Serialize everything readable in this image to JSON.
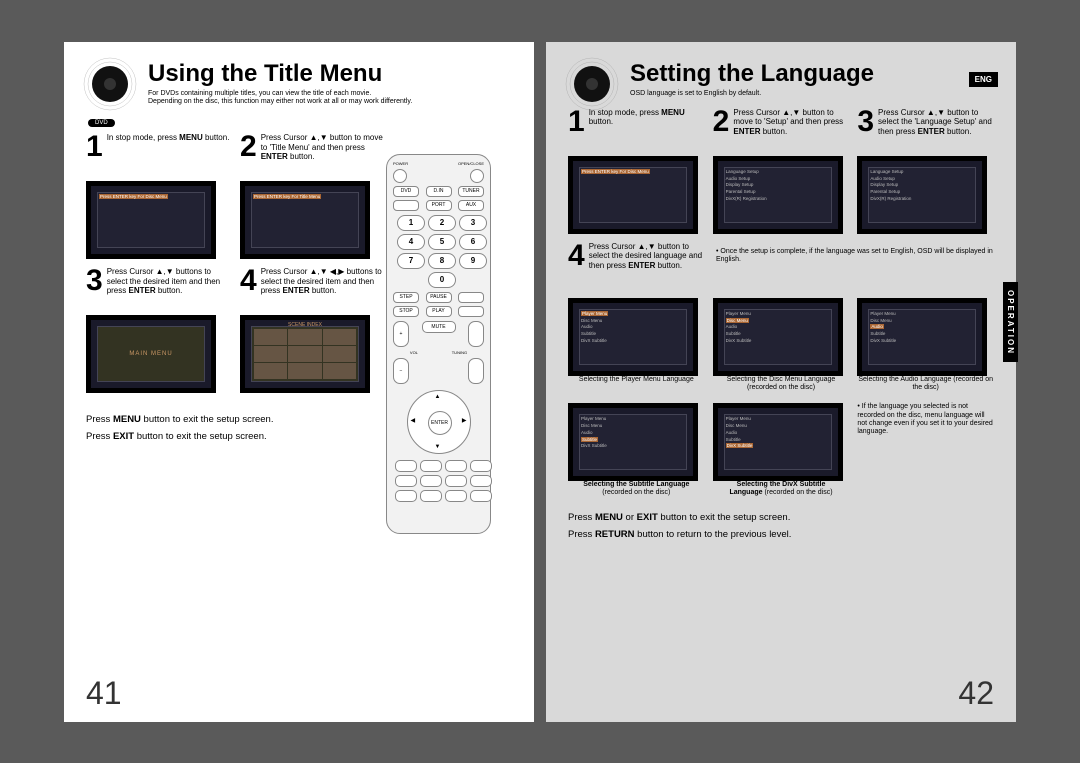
{
  "leftPage": {
    "title": "Using the Title Menu",
    "subtitle1": "For DVDs containing multiple titles, you can view the title of each movie.",
    "subtitle2": "Depending on the disc, this function may either not work at all or may work differently.",
    "badge": "DVD",
    "step1": "In stop mode, press MENU button.",
    "step2": "Press Cursor ▲,▼ button to move to 'Title Menu' and then press ENTER button.",
    "step3": "Press Cursor ▲,▼ buttons to select the desired item and then press ENTER button.",
    "step4": "Press Cursor ▲,▼ ◀,▶ buttons to select the desired item and then press ENTER button.",
    "footer1": "Press MENU button to exit the setup screen.",
    "footer2": "Press EXIT button to exit the setup screen.",
    "pageNum": "41",
    "screenHint1": "Press ENTER key For Disc Menu",
    "screenHint2": "Press ENTER key For Title Menu",
    "screenLabel3": "MAIN MENU",
    "screenLabel4": "SCENE INDEX"
  },
  "rightPage": {
    "title": "Setting the Language",
    "subtitle": "OSD language is set to English by default.",
    "badgeEng": "ENG",
    "tab": "OPERATION",
    "step1": "In stop mode, press MENU button.",
    "step2": "Press Cursor ▲,▼ button to move to 'Setup' and then press ENTER button.",
    "step3": "Press Cursor ▲,▼ button to select the 'Language Setup' and then press ENTER button.",
    "step4": "Press Cursor ▲,▼ button to select the desired language and then press ENTER button.",
    "note1": "Once the setup is complete, if the language was set to English, OSD will be displayed in English.",
    "cap1": "Selecting the Player Menu Language",
    "cap2": "Selecting the Disc Menu Language (recorded on the disc)",
    "cap3": "Selecting the Audio Language (recorded on the disc)",
    "cap4": "Selecting the Subtitle Language (recorded on the disc)",
    "cap5": "Selecting the DivX Subtitle Language (recorded on the disc)",
    "note2": "If the language you selected is not recorded on the disc, menu language will not change even if you set it to your desired language.",
    "footer1": "Press MENU or EXIT button to exit the setup screen.",
    "footer2": "Press RETURN button to return to the previous level.",
    "pageNum": "42",
    "menuItems": "Language Setup\nAudio Setup\nDisplay Setup\nParental Setup\nDivX(R) Registration"
  },
  "remote": {
    "power": "POWER",
    "open": "OPEN/CLOSE",
    "enter": "ENTER"
  }
}
